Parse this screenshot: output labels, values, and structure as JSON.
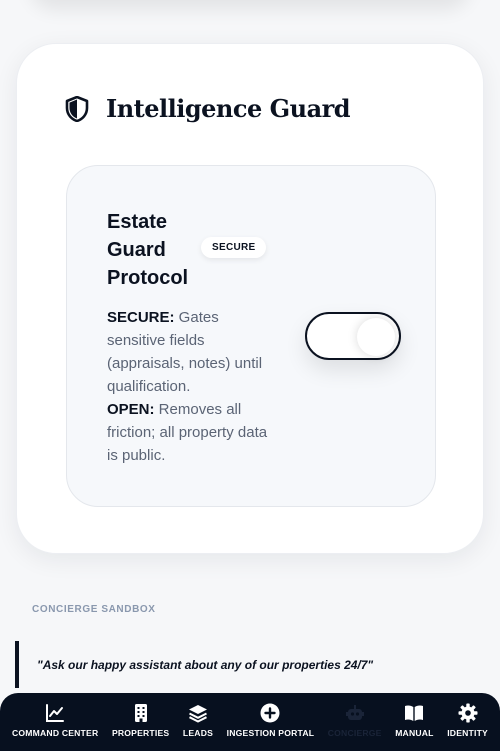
{
  "guard": {
    "title": "Intelligence Guard",
    "protocol_title": "Estate Guard Protocol",
    "badge": "SECURE",
    "secure_label": "SECURE:",
    "secure_text": " Gates sensitive fields (appraisals, notes) until qualification.",
    "open_label": "OPEN:",
    "open_text": " Removes all friction; all property data is public.",
    "toggle_state": "on"
  },
  "sandbox": {
    "label": "CONCIERGE SANDBOX",
    "quote": "\"Ask our happy assistant about any of our properties 24/7\""
  },
  "nav": {
    "items": [
      {
        "label": "COMMAND CENTER",
        "icon": "chart-line-icon"
      },
      {
        "label": "PROPERTIES",
        "icon": "building-icon"
      },
      {
        "label": "LEADS",
        "icon": "layers-icon"
      },
      {
        "label": "INGESTION PORTAL",
        "icon": "plus-circle-icon"
      },
      {
        "label": "CONCIERGE",
        "icon": "robot-icon"
      },
      {
        "label": "MANUAL",
        "icon": "book-icon"
      },
      {
        "label": "IDENTITY",
        "icon": "gear-icon"
      }
    ]
  }
}
